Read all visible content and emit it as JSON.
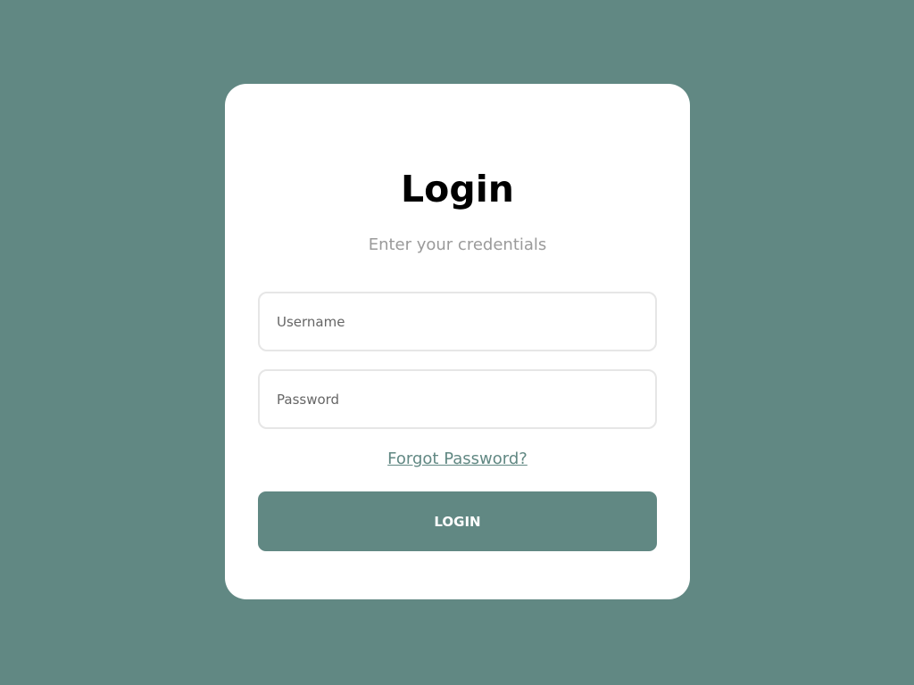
{
  "colors": {
    "background": "#618883",
    "card": "#ffffff",
    "accent": "#618883",
    "subtitle": "#9a9a9a",
    "field_border": "#e6e6e6"
  },
  "login_form": {
    "title": "Login",
    "subtitle": "Enter your credentials",
    "username": {
      "value": "",
      "placeholder": "Username"
    },
    "password": {
      "value": "",
      "placeholder": "Password"
    },
    "forgot_password_label": "Forgot Password?",
    "submit_label": "LOGIN"
  }
}
